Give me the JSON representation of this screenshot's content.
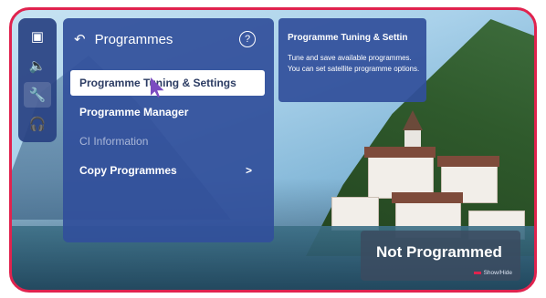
{
  "side_menu": {
    "items": [
      {
        "icon": "picture-icon",
        "glyph": "▣"
      },
      {
        "icon": "sound-icon",
        "glyph": "🔈"
      },
      {
        "icon": "wrench-icon",
        "glyph": "🔧"
      },
      {
        "icon": "headset-icon",
        "glyph": "🎧"
      }
    ]
  },
  "panel": {
    "title": "Programmes",
    "back_glyph": "↶",
    "help_glyph": "?",
    "items": [
      {
        "label": "Programme Tuning & Settings",
        "state": "selected"
      },
      {
        "label": "Programme Manager",
        "state": "normal"
      },
      {
        "label": "CI Information",
        "state": "disabled"
      },
      {
        "label": "Copy Programmes",
        "state": "normal",
        "chevron": ">"
      }
    ]
  },
  "info_box": {
    "title": "Programme Tuning & Settin",
    "text": "Tune and save available programmes. You can set satellite programme options."
  },
  "status": {
    "title": "Not Programmed",
    "hint": "Show/Hide"
  },
  "colors": {
    "border": "#e0234e",
    "panel": "#3250a0"
  }
}
